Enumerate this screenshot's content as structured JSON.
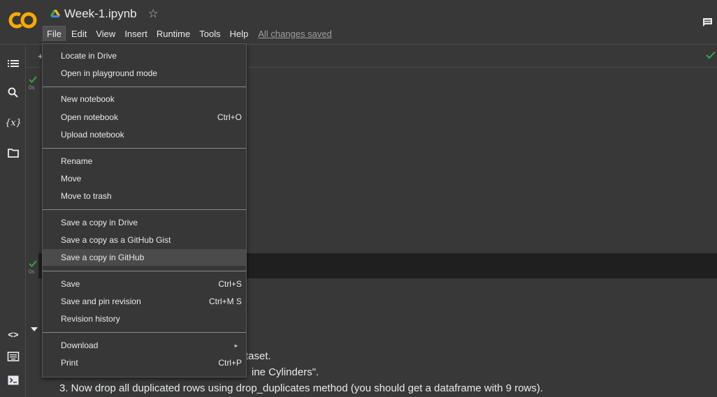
{
  "app": {
    "notebook_title": "Week-1.ipynb",
    "logo_text": "CO",
    "saved_status": "All changes saved"
  },
  "menubar": {
    "items": [
      "File",
      "Edit",
      "View",
      "Insert",
      "Runtime",
      "Tools",
      "Help"
    ]
  },
  "toolbar": {
    "add_label": "+"
  },
  "sidebar": {
    "icons": [
      "table-of-contents-icon",
      "search-icon",
      "variables-icon",
      "folder-icon",
      "code-snippets-icon",
      "command-palette-icon",
      "terminal-icon"
    ],
    "variables_glyph": "{x}",
    "code_glyph": "<>"
  },
  "cells": {
    "run_time_1": "0s",
    "run_time_2": "0s",
    "partial_line_1": "taset.",
    "partial_line_2a": "                                                           ",
    "partial_line_2": "ine Cylinders\".",
    "line_3": "3. Now drop all duplicated rows using drop_duplicates method (you should get a dataframe with 9 rows)."
  },
  "file_menu": {
    "group1": [
      {
        "label": "Locate in Drive",
        "shortcut": ""
      },
      {
        "label": "Open in playground mode",
        "shortcut": ""
      }
    ],
    "group2": [
      {
        "label": "New notebook",
        "shortcut": ""
      },
      {
        "label": "Open notebook",
        "shortcut": "Ctrl+O"
      },
      {
        "label": "Upload notebook",
        "shortcut": ""
      }
    ],
    "group3": [
      {
        "label": "Rename",
        "shortcut": ""
      },
      {
        "label": "Move",
        "shortcut": ""
      },
      {
        "label": "Move to trash",
        "shortcut": ""
      }
    ],
    "group4": [
      {
        "label": "Save a copy in Drive",
        "shortcut": ""
      },
      {
        "label": "Save a copy as a GitHub Gist",
        "shortcut": ""
      },
      {
        "label": "Save a copy in GitHub",
        "shortcut": ""
      }
    ],
    "group5": [
      {
        "label": "Save",
        "shortcut": "Ctrl+S"
      },
      {
        "label": "Save and pin revision",
        "shortcut": "Ctrl+M S"
      },
      {
        "label": "Revision history",
        "shortcut": ""
      }
    ],
    "group6": [
      {
        "label": "Download",
        "shortcut": ""
      },
      {
        "label": "Print",
        "shortcut": "Ctrl+P"
      }
    ]
  },
  "colors": {
    "background": "#383838",
    "menu_bg": "#373737",
    "highlight": "#4b4b4b",
    "check_green": "#34a853",
    "logo_orange": "#f9ab00"
  }
}
